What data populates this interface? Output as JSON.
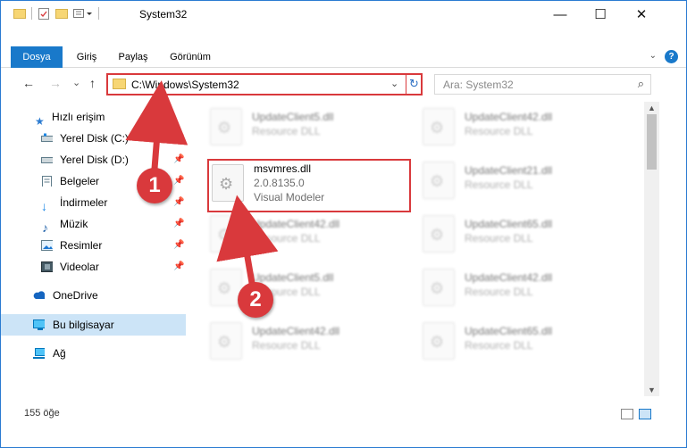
{
  "window": {
    "title": "System32",
    "minimize": "—",
    "maximize": "☐",
    "close": "✕"
  },
  "ribbon": {
    "tabs": [
      {
        "label": "Dosya"
      },
      {
        "label": "Giriş"
      },
      {
        "label": "Paylaş"
      },
      {
        "label": "Görünüm"
      }
    ],
    "help": "?"
  },
  "nav": {
    "back": "←",
    "forward": "→",
    "recent": "⌄",
    "up": "↑",
    "address": "C:\\Windows\\System32",
    "search_placeholder": "Ara: System32"
  },
  "sidebar": {
    "items": [
      {
        "label": "Hızlı erişim",
        "icon": "star-icon",
        "pinned": false
      },
      {
        "label": "Yerel Disk (C:)",
        "icon": "drive-icon",
        "pinned": true
      },
      {
        "label": "Yerel Disk (D:)",
        "icon": "drive-icon",
        "pinned": true
      },
      {
        "label": "Belgeler",
        "icon": "document-icon",
        "pinned": true
      },
      {
        "label": "İndirmeler",
        "icon": "download-icon",
        "pinned": true
      },
      {
        "label": "Müzik",
        "icon": "music-icon",
        "pinned": true
      },
      {
        "label": "Resimler",
        "icon": "picture-icon",
        "pinned": true
      },
      {
        "label": "Videolar",
        "icon": "film-icon",
        "pinned": true
      },
      {
        "label": "OneDrive",
        "icon": "cloud-icon",
        "pinned": false
      },
      {
        "label": "Bu bilgisayar",
        "icon": "computer-icon",
        "pinned": false
      },
      {
        "label": "Ağ",
        "icon": "network-icon",
        "pinned": false
      }
    ]
  },
  "files": [
    {
      "name": "UpdateClient5.dll",
      "type": "Resource DLL"
    },
    {
      "name": "UpdateClient42.dll",
      "type": "Resource DLL"
    },
    {
      "name": "msvmres.dll",
      "version": "2.0.8135.0",
      "type": "Visual Modeler"
    },
    {
      "name": "UpdateClient21.dll",
      "type": "Resource DLL"
    },
    {
      "name": "UpdateClient42.dll",
      "type": "Resource DLL"
    },
    {
      "name": "UpdateClient65.dll",
      "type": "Resource DLL"
    },
    {
      "name": "UpdateClient5.dll",
      "type": "Resource DLL"
    },
    {
      "name": "UpdateClient42.dll",
      "type": "Resource DLL"
    },
    {
      "name": "UpdateClient42.dll",
      "type": "Resource DLL"
    },
    {
      "name": "UpdateClient65.dll",
      "type": "Resource DLL"
    }
  ],
  "status": {
    "item_count": "155 öğe"
  },
  "annotations": {
    "step1": "1",
    "step2": "2"
  },
  "colors": {
    "accent": "#1979ca",
    "highlight": "#d9393c",
    "selection": "#cce4f7"
  }
}
